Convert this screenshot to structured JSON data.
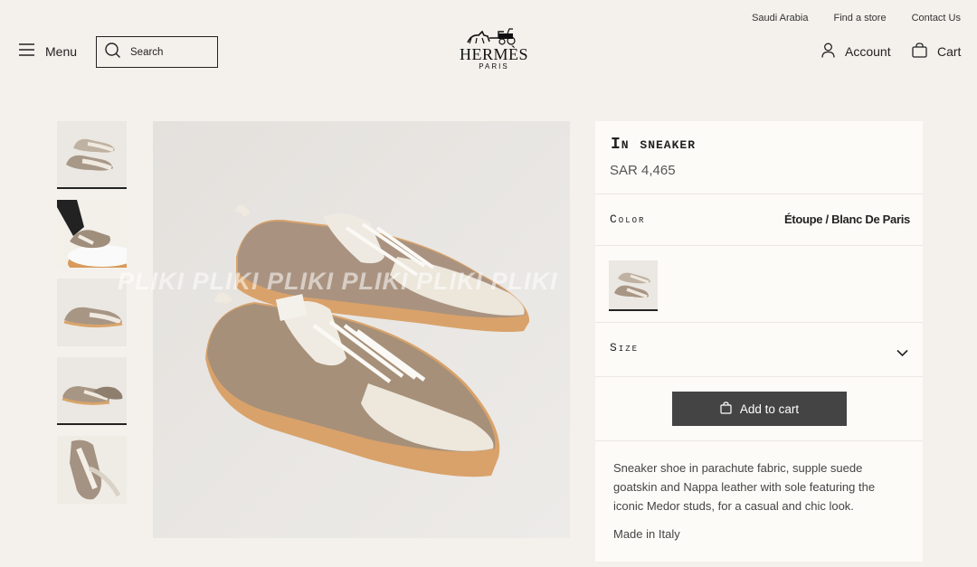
{
  "header": {
    "util_links": [
      "Saudi Arabia",
      "Find a store",
      "Contact Us"
    ],
    "menu_label": "Menu",
    "search_placeholder": "Search",
    "logo_brand": "HERMÈS",
    "logo_city": "PARIS",
    "account_label": "Account",
    "cart_label": "Cart"
  },
  "product": {
    "title": "In sneaker",
    "price": "SAR 4,465",
    "color_label": "Color",
    "color_value": "Étoupe / Blanc De Paris",
    "size_label": "Size",
    "add_to_cart": "Add to cart",
    "description": "Sneaker shoe in parachute fabric, supple suede goatskin and Nappa leather with sole featuring the iconic Medor studs, for a casual and chic look.",
    "made_in": "Made in Italy"
  },
  "gallery": {
    "thumbnail_count": 5,
    "watermark": "PLIKI   PLIKI   PLIKI   PLIKI   PLIKI   PLIKI"
  },
  "icons": {
    "menu": "hamburger-icon",
    "search": "search-icon",
    "account": "user-icon",
    "cart": "bag-icon",
    "chevron": "chevron-down-icon",
    "add_bag": "bag-icon"
  },
  "colors": {
    "background": "#f4f1ec",
    "panel": "#fdfbf7",
    "button": "#444444"
  }
}
